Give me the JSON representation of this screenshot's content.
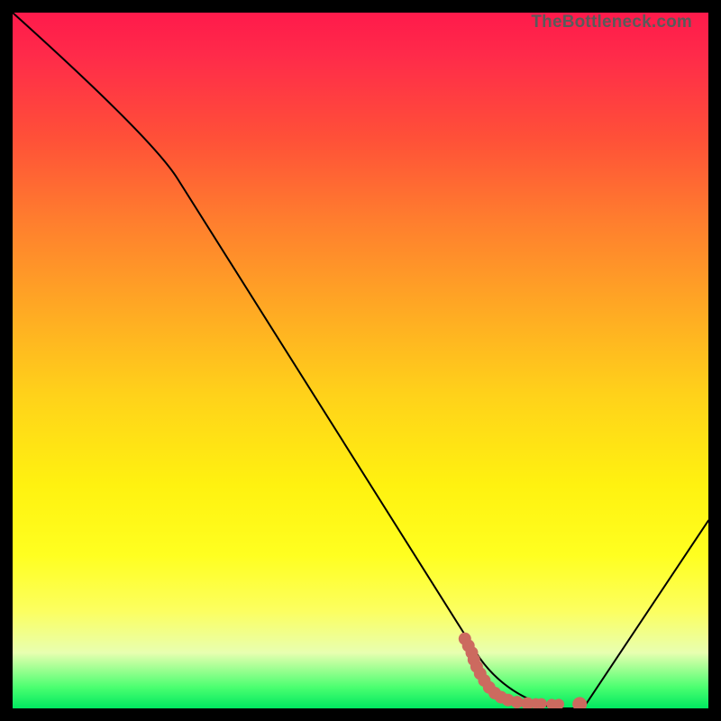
{
  "attribution": "TheBottleneck.com",
  "chart_data": {
    "type": "line",
    "title": "",
    "xlabel": "",
    "ylabel": "",
    "xlim": [
      0,
      100
    ],
    "ylim": [
      0,
      100
    ],
    "curve": {
      "name": "bottleneck-curve",
      "x": [
        0,
        20,
        66,
        70,
        78,
        82,
        100
      ],
      "y": [
        100,
        82,
        9,
        2,
        0,
        0,
        27
      ]
    },
    "series": [
      {
        "name": "highlight-points",
        "x": [
          65.0,
          65.5,
          66.0,
          66.3,
          66.7,
          67.2,
          67.8,
          68.5,
          69.3,
          70.2,
          71.2,
          72.5,
          74.0,
          75.2,
          76.0,
          77.5,
          78.5,
          81.5
        ],
        "y": [
          10.0,
          9.0,
          8.0,
          7.0,
          6.0,
          5.0,
          4.0,
          3.0,
          2.2,
          1.6,
          1.2,
          0.9,
          0.7,
          0.7,
          0.7,
          0.6,
          0.6,
          0.6
        ],
        "r": [
          7,
          7,
          7,
          7,
          7,
          7,
          7,
          7,
          7,
          7,
          7,
          7,
          7,
          6,
          6,
          6,
          6,
          8
        ]
      }
    ]
  }
}
